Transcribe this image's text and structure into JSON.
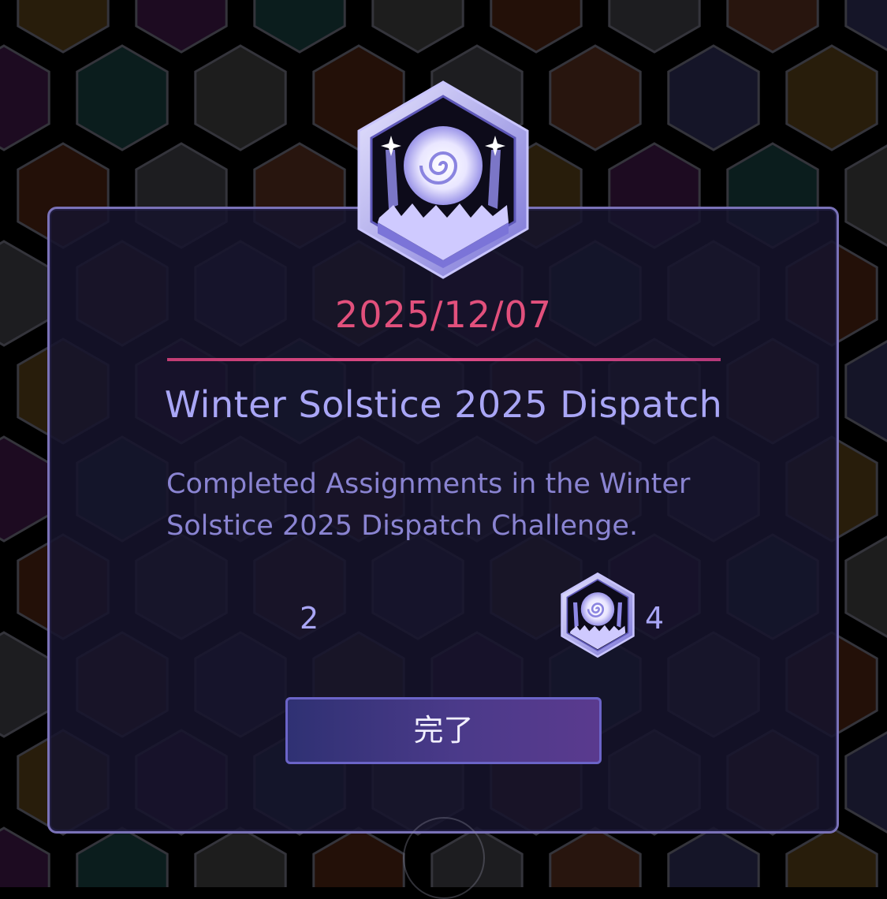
{
  "medal": {
    "icon": "winter-solstice-dispatch-medal-icon",
    "date": "2025/12/07",
    "title": "Winter Solstice 2025 Dispatch",
    "description_line1": "Completed Assignments in the Winter",
    "description_line2": "Solstice 2025 Dispatch Challenge."
  },
  "progress": {
    "left_count": "2",
    "right_count": "4"
  },
  "buttons": {
    "done_label": "完了"
  },
  "colors": {
    "accent_pink": "#e2507c",
    "title_lavender": "#a9a6f6",
    "panel_border": "#7a72b8"
  }
}
